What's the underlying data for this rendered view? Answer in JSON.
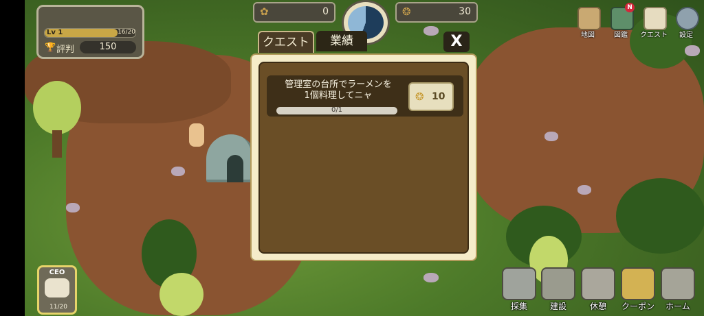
{
  "status": {
    "level_label": "Lv 1",
    "level_progress_text": "16/20",
    "level_progress_fraction": 0.8,
    "reputation_label": "評判",
    "reputation_value": "150"
  },
  "resources": {
    "left_value": "0",
    "right_value": "30"
  },
  "top_menu": {
    "map": "地図",
    "encyclopedia": "図鑑",
    "encyclopedia_badge": "N",
    "quest": "クエスト",
    "settings": "設定"
  },
  "quest_dialog": {
    "tab_quest": "クエスト",
    "tab_achievements": "業績",
    "close": "X",
    "quests": [
      {
        "text": "管理室の台所でラーメンを\n1個料理してニャ",
        "progress_text": "0/1",
        "progress_fraction": 0,
        "reward": "10"
      }
    ]
  },
  "ceo": {
    "label": "CEO",
    "count": "11/20"
  },
  "bottom_menu": {
    "gather": "採集",
    "build": "建設",
    "rest": "休憩",
    "coupon": "クーポン",
    "home": "ホーム"
  },
  "colors": {
    "dialog_bg": "#6a4e26",
    "dialog_border": "#f5ecc9",
    "accent_gold": "#c79a32"
  }
}
